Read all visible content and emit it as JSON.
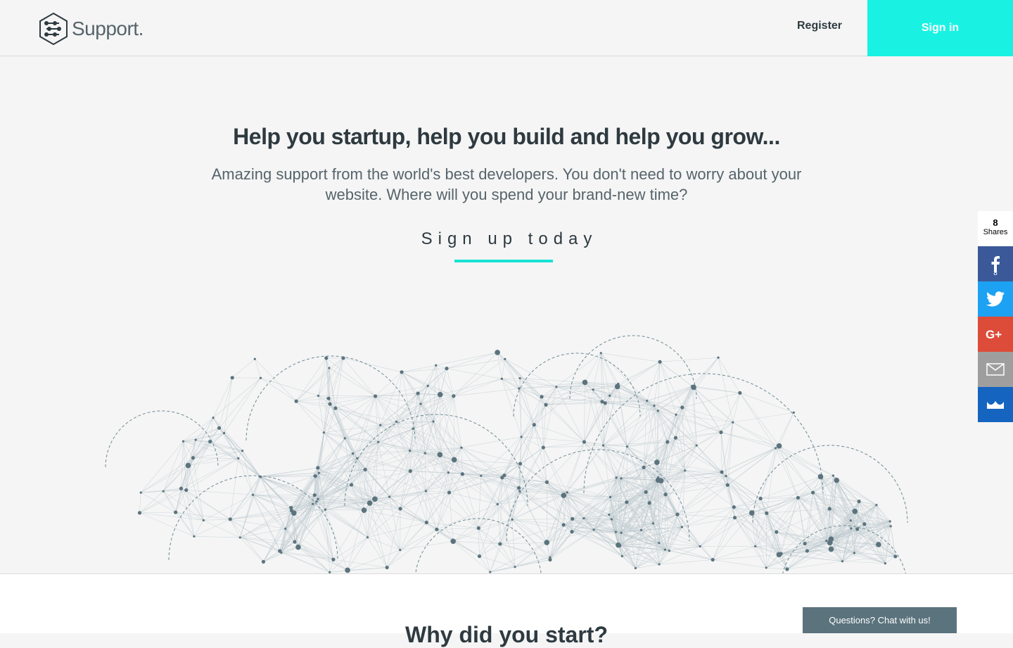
{
  "header": {
    "logo_text": "Support.",
    "register_label": "Register",
    "signin_label": "Sign in"
  },
  "hero": {
    "title": "Help you startup, help you build and help you grow...",
    "subtitle": "Amazing support from the world's best developers. You don't need to worry about your website. Where will you spend your brand-new time?",
    "cta_label": "Sign up today"
  },
  "section": {
    "title": "Why did you start?"
  },
  "share": {
    "count": "8",
    "count_label": "Shares",
    "facebook_count": "8",
    "buttons": [
      {
        "icon": "facebook-icon"
      },
      {
        "icon": "twitter-icon"
      },
      {
        "icon": "google-plus-icon"
      },
      {
        "icon": "email-icon"
      },
      {
        "icon": "sumome-icon"
      }
    ]
  },
  "chat": {
    "label": "Questions? Chat with us!"
  },
  "colors": {
    "accent": "#19f2e3",
    "text": "#2e3a40",
    "node": "#5b737d"
  }
}
